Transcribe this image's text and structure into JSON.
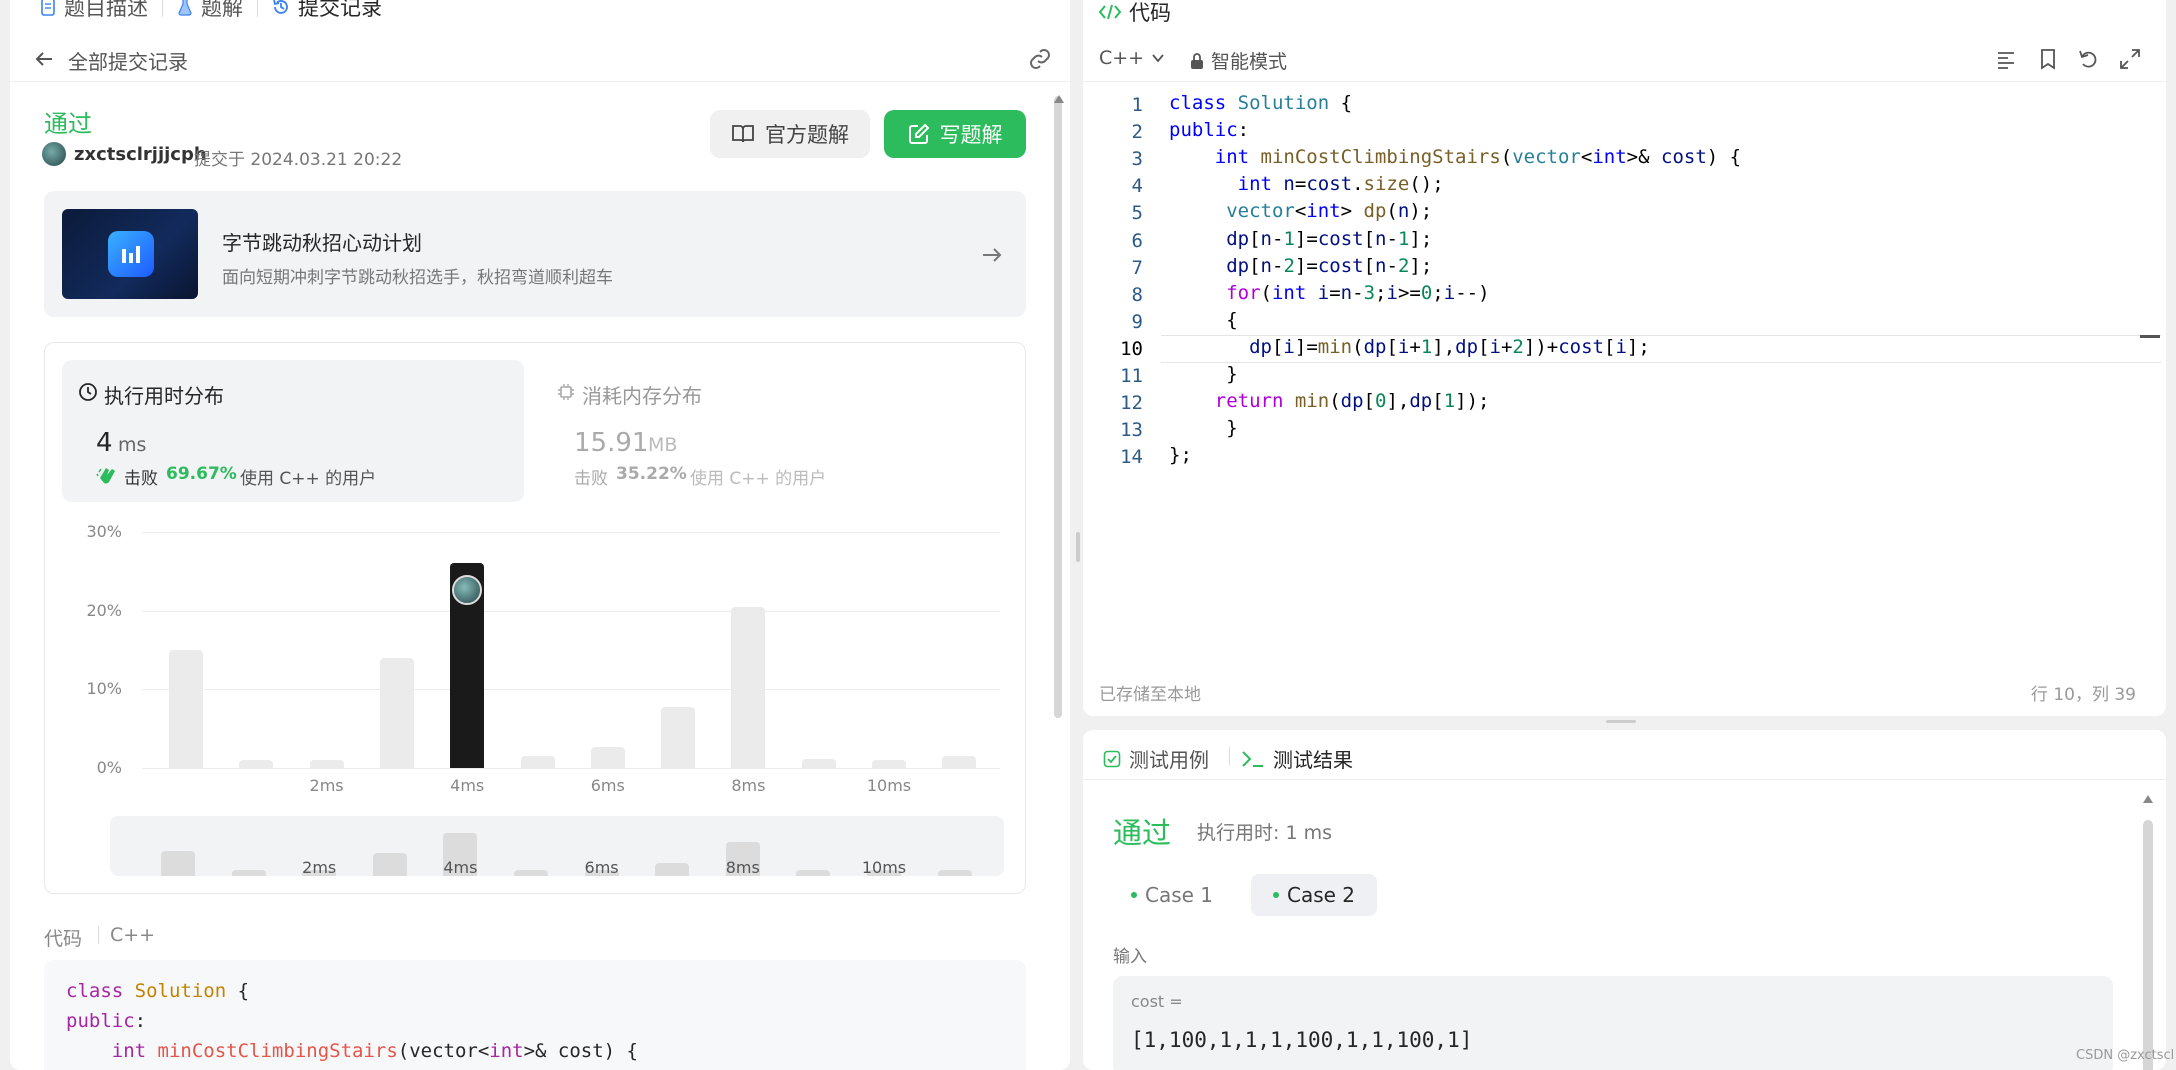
{
  "left_tabs": [
    "题目描述",
    "题解",
    "提交记录"
  ],
  "breadcrumb_back": "全部提交记录",
  "submission": {
    "status": "通过",
    "user": "zxctsclrjjjcph",
    "submitted_at": "提交于 2024.03.21 20:22",
    "official_solution_btn": "官方题解",
    "write_solution_btn": "写题解"
  },
  "promo": {
    "title": "字节跳动秋招心动计划",
    "subtitle": "面向短期冲刺字节跳动秋招选手，秋招弯道顺利超车"
  },
  "runtime": {
    "label": "执行用时分布",
    "value": "4",
    "unit": "ms",
    "beat_prefix": "击败",
    "beat_pct": "69.67%",
    "beat_suffix": "使用 C++ 的用户"
  },
  "memory": {
    "label": "消耗内存分布",
    "value": "15.91",
    "unit": "MB",
    "beat_prefix": "击败",
    "beat_pct": "35.22%",
    "beat_suffix": "使用 C++ 的用户"
  },
  "chart_data": {
    "type": "bar",
    "x_tick_labels": [
      "2ms",
      "4ms",
      "6ms",
      "8ms",
      "10ms"
    ],
    "y_tick_labels": [
      "30%",
      "20%",
      "10%",
      "0%"
    ],
    "ylim": [
      0,
      30
    ],
    "values": [
      15,
      1,
      1,
      14,
      26,
      1.5,
      2.7,
      7.8,
      20.5,
      1.2,
      1,
      1.5
    ],
    "highlight_index": 4,
    "grid": true
  },
  "code_section_label": "代码",
  "code_section_lang": "C++",
  "left_code_lines": [
    "class Solution {",
    "public:",
    "    int minCostClimbingStairs(vector<int>& cost) {"
  ],
  "editor": {
    "header": "代码",
    "language": "C++",
    "mode": "智能模式",
    "lines": [
      "class Solution {",
      "public:",
      "    int minCostClimbingStairs(vector<int>& cost) {",
      "      int n=cost.size();",
      "     vector<int> dp(n);",
      "     dp[n-1]=cost[n-1];",
      "     dp[n-2]=cost[n-2];",
      "     for(int i=n-3;i>=0;i--)",
      "     {",
      "       dp[i]=min(dp[i+1],dp[i+2])+cost[i];",
      "     }",
      "    return min(dp[0],dp[1]);",
      "     }",
      "};"
    ],
    "line_numbers": [
      "1",
      "2",
      "3",
      "4",
      "5",
      "6",
      "7",
      "8",
      "9",
      "10",
      "11",
      "12",
      "13",
      "14"
    ],
    "saved_status": "已存储至本地",
    "cursor_pos": "行 10，列 39"
  },
  "tests": {
    "tab_cases": "测试用例",
    "tab_result": "测试结果",
    "status": "通过",
    "runtime": "执行用时: 1 ms",
    "cases": [
      "Case 1",
      "Case 2"
    ],
    "input_label": "输入",
    "param_name": "cost =",
    "param_value": "[1,100,1,1,1,100,1,1,100,1]"
  },
  "watermark": "CSDN @zxctscl",
  "colors": {
    "accent_green": "#2cbb5d",
    "bar_highlight": "#1a1a1a",
    "bar_default": "#ebebeb"
  }
}
